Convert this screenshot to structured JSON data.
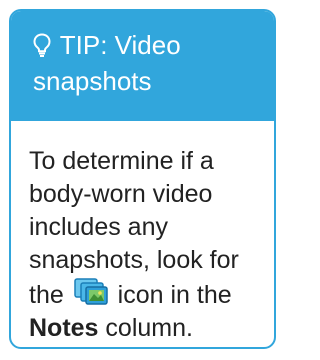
{
  "tip": {
    "header_title": "TIP: Video snapshots",
    "body_before_icon": "To determine if a body-worn video includes any snapshots, look for the",
    "body_after_icon": "icon in the",
    "body_strong": "Notes",
    "body_end": "column.",
    "header_icon": "lightbulb-icon",
    "inline_icon": "snapshots-icon"
  },
  "colors": {
    "accent": "#31a6dc",
    "header_text": "#ffffff",
    "body_text": "#222222"
  }
}
